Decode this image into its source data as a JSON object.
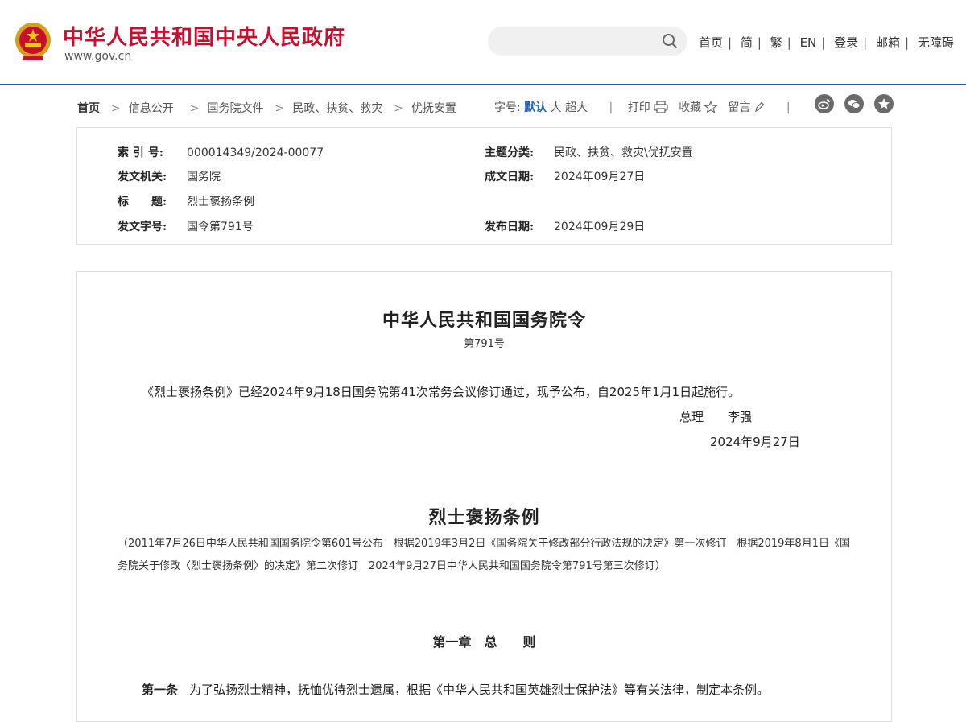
{
  "site": {
    "name": "中华人民共和国中央人民政府",
    "domain": "www.gov.cn"
  },
  "search": {
    "placeholder": ""
  },
  "topnav": [
    "首页",
    "简",
    "繁",
    "EN",
    "登录",
    "邮箱",
    "无障碍"
  ],
  "breadcrumb": [
    "首页",
    "信息公开",
    "国务院文件",
    "民政、扶贫、救灾",
    "优抚安置"
  ],
  "tools": {
    "font_label": "字号:",
    "font_default": "默认",
    "font_large": "大",
    "font_xlarge": "超大",
    "print": "打印",
    "favorite": "收藏",
    "comment": "留言"
  },
  "social_icons": [
    "weibo-icon",
    "wechat-icon",
    "star-icon"
  ],
  "meta": {
    "index_label": "索 引 号:",
    "index_value": "000014349/2024-00077",
    "topic_label": "主题分类:",
    "topic_value": "民政、扶贫、救灾\\优抚安置",
    "issuer_label": "发文机关:",
    "issuer_value": "国务院",
    "written_label": "成文日期:",
    "written_value": "2024年09月27日",
    "title_label": "标　　题:",
    "title_value": "烈士褒扬条例",
    "docno_label": "发文字号:",
    "docno_value": "国令第791号",
    "publish_label": "发布日期:",
    "publish_value": "2024年09月29日"
  },
  "document": {
    "order_title": "中华人民共和国国务院令",
    "order_no": "第791号",
    "intro": "《烈士褒扬条例》已经2024年9月18日国务院第41次常务会议修订通过，现予公布，自2025年1月1日起施行。",
    "signer": "总理　　李强",
    "sign_date": "2024年9月27日",
    "reg_title": "烈士褒扬条例",
    "history": "（2011年7月26日中华人民共和国国务院令第601号公布　根据2019年3月2日《国务院关于修改部分行政法规的决定》第一次修订　根据2019年8月1日《国务院关于修改〈烈士褒扬条例〉的决定》第二次修订　2024年9月27日中华人民共和国国务院令第791号第三次修订）",
    "chapter": "第一章　总　　则",
    "article_no": "第一条",
    "article_text": "为了弘扬烈士精神，抚恤优待烈士遗属，根据《中华人民共和国英雄烈士保护法》等有关法律，制定本条例。"
  },
  "colors": {
    "brand_red": "#c8102e",
    "accent_blue": "#1f5bb3"
  }
}
